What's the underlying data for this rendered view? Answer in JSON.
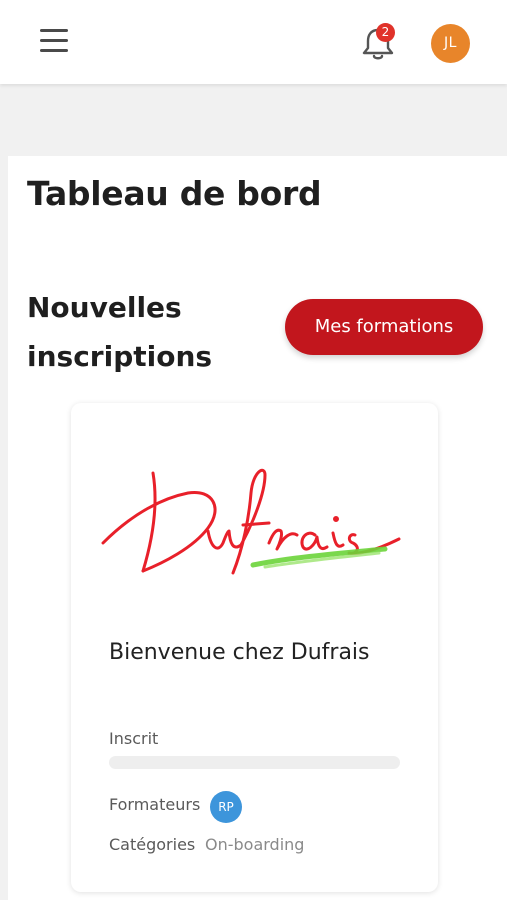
{
  "header": {
    "menu_icon": "hamburger-menu-icon",
    "notifications": {
      "icon": "bell-icon",
      "count": "2"
    },
    "user": {
      "initials": "JL",
      "color": "#e8852a"
    }
  },
  "page": {
    "title": "Tableau de bord"
  },
  "section": {
    "title": "Nouvelles inscriptions",
    "button_label": "Mes formations",
    "accent_color": "#c2161d"
  },
  "course_card": {
    "logo_text": "Dufrais",
    "title": "Bienvenue chez Dufrais",
    "status_label": "Inscrit",
    "progress": 0,
    "trainers_label": "Formateurs",
    "trainer_initials": "RP",
    "categories_label": "Catégories",
    "categories_value": "On-boarding"
  }
}
